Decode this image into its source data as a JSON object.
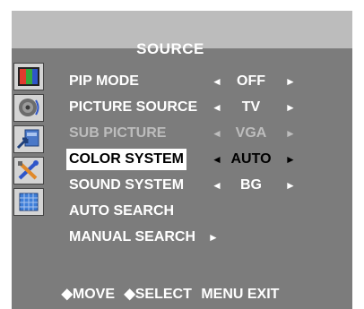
{
  "menu": {
    "title": "SOURCE",
    "rows": [
      {
        "label": "PIP MODE",
        "left_arrow": "◄",
        "value": "OFF",
        "right_arrow": "►"
      },
      {
        "label": "PICTURE SOURCE",
        "left_arrow": "◄",
        "value": "TV",
        "right_arrow": "►"
      },
      {
        "label": "SUB PICTURE",
        "left_arrow": "◄",
        "value": "VGA",
        "right_arrow": "►",
        "disabled": true
      },
      {
        "label": "COLOR SYSTEM",
        "left_arrow": "◄",
        "value": "AUTO",
        "right_arrow": "►",
        "selected": true
      },
      {
        "label": "SOUND SYSTEM",
        "left_arrow": "◄",
        "value": "BG",
        "right_arrow": "►"
      },
      {
        "label": "AUTO SEARCH"
      },
      {
        "label": "MANUAL SEARCH",
        "right_arrow": "►"
      }
    ]
  },
  "icons": [
    "color-bars-icon",
    "speaker-icon",
    "input-source-icon",
    "tools-icon",
    "grid-screen-icon"
  ],
  "footer": {
    "move": "◆MOVE",
    "select": "◆SELECT",
    "exit": "MENU EXIT"
  },
  "colors": {
    "panel": "#7c7c7c",
    "top_band": "#bcbcbc",
    "text": "#ffffff",
    "disabled_text": "#bdbdbd",
    "highlight": "#ffffff"
  }
}
